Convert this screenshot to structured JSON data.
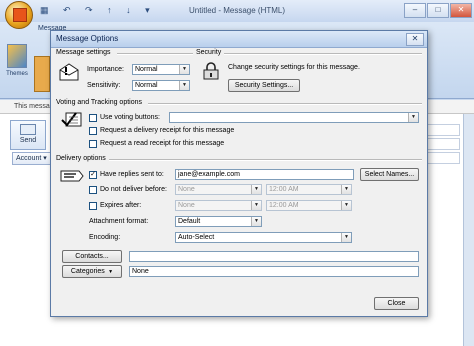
{
  "bg": {
    "title": "Untitled - Message (HTML)",
    "ribbon_tab_message": "Message",
    "themes_label": "Themes",
    "infobar": "This message",
    "send_label": "Send",
    "account_label": "Account ▾"
  },
  "dialog": {
    "title": "Message Options",
    "close_icon": "✕",
    "message_settings": {
      "header": "Message settings",
      "importance_label": "Importance:",
      "importance_value": "Normal",
      "sensitivity_label": "Sensitivity:",
      "sensitivity_value": "Normal"
    },
    "security": {
      "header": "Security",
      "text": "Change security settings for this message.",
      "button": "Security Settings..."
    },
    "voting": {
      "header": "Voting and Tracking options",
      "use_voting": "Use voting buttons:",
      "delivery_receipt": "Request a delivery receipt for this message",
      "read_receipt": "Request a read receipt for this message"
    },
    "delivery": {
      "header": "Delivery options",
      "replies_label": "Have replies sent to:",
      "replies_value": "jane@example.com",
      "select_names": "Select Names...",
      "not_before_label": "Do not deliver before:",
      "not_before_date": "None",
      "not_before_time": "12:00 AM",
      "expires_label": "Expires after:",
      "expires_date": "None",
      "expires_time": "12:00 AM",
      "format_label": "Attachment format:",
      "format_value": "Default",
      "encoding_label": "Encoding:",
      "encoding_value": "Auto-Select"
    },
    "contacts_button": "Contacts...",
    "categories_button": "Categories",
    "categories_value": "None",
    "close_button": "Close"
  }
}
